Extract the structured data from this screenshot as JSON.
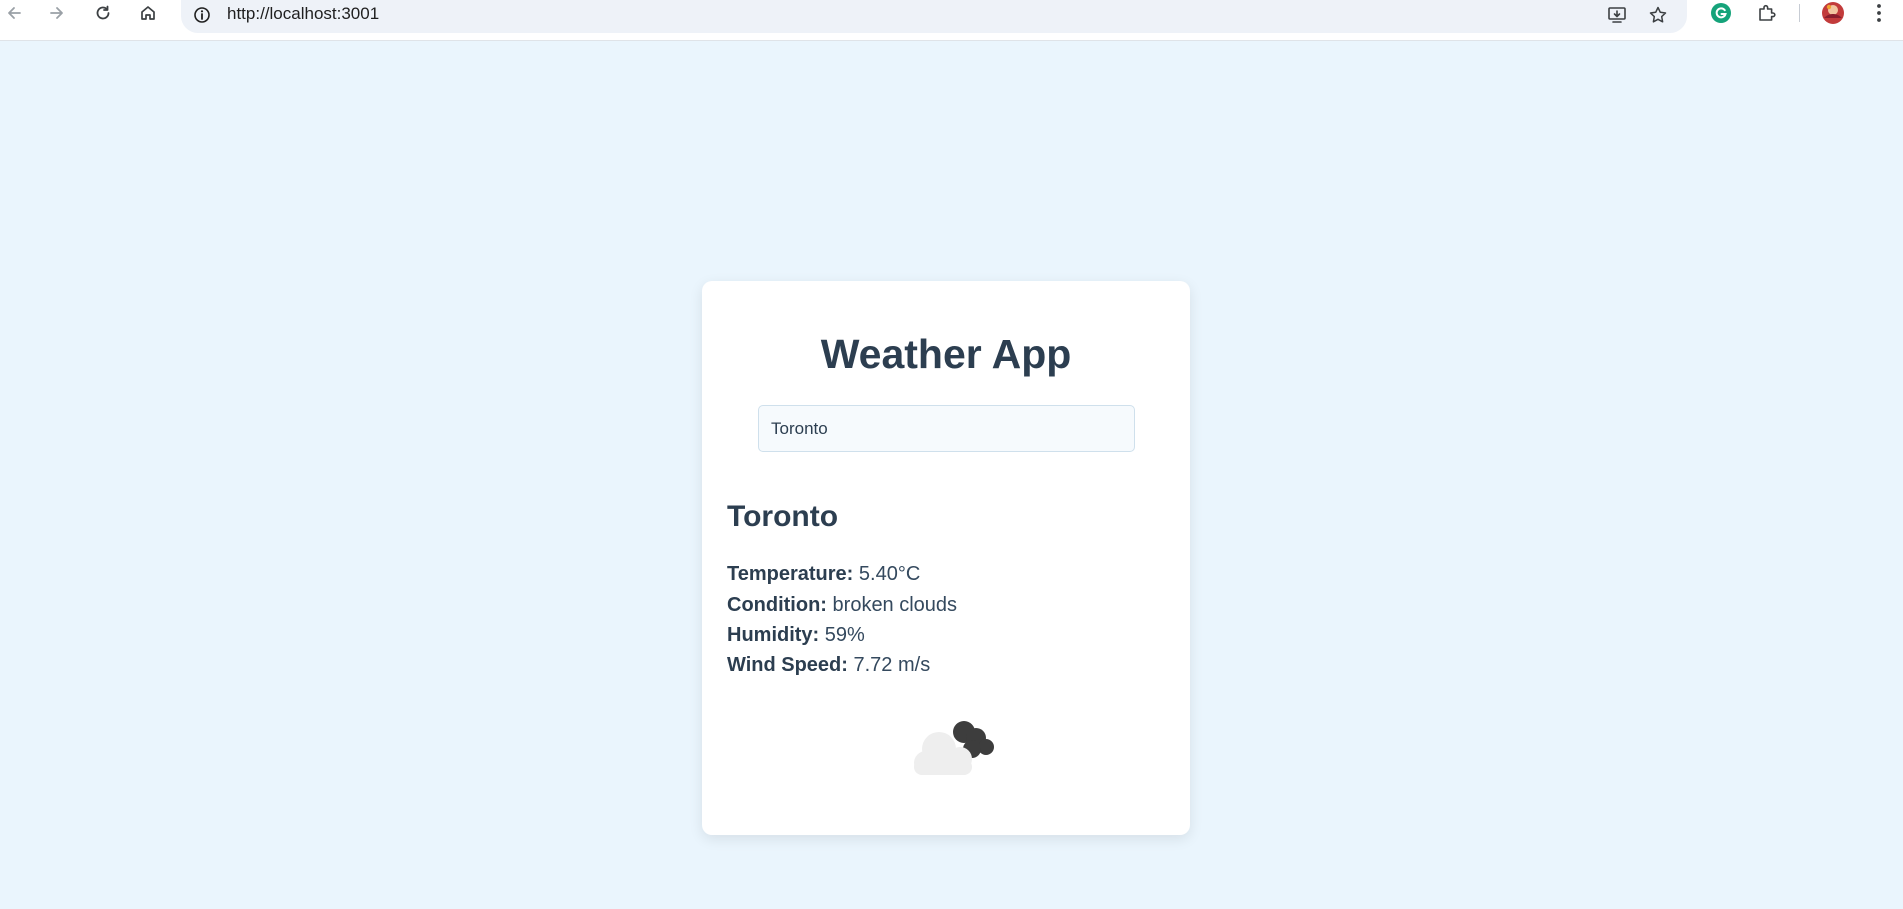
{
  "browser": {
    "url": "http://localhost:3001"
  },
  "app": {
    "title": "Weather App",
    "search": {
      "value": "Toronto"
    }
  },
  "weather": {
    "city": "Toronto",
    "temperature_label": "Temperature:",
    "temperature_value": "5.40°C",
    "condition_label": "Condition:",
    "condition_value": "broken clouds",
    "humidity_label": "Humidity:",
    "humidity_value": "59%",
    "wind_label": "Wind Speed:",
    "wind_value": "7.72 m/s",
    "icon": "broken-clouds-icon"
  },
  "colors": {
    "page_background": "#eaf5fd",
    "card_background": "#ffffff",
    "heading": "#2c3e50"
  }
}
